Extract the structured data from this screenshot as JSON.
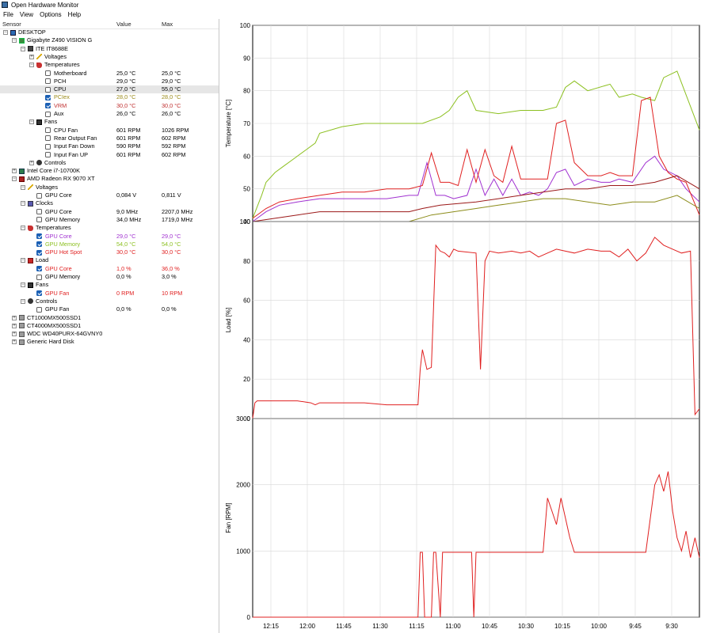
{
  "window": {
    "title": "Open Hardware Monitor"
  },
  "menu": [
    "File",
    "View",
    "Options",
    "Help"
  ],
  "columns": {
    "sensor": "Sensor",
    "value": "Value",
    "max": "Max"
  },
  "tree": [
    {
      "indent": 0,
      "exp": "-",
      "icon": "monitor",
      "label": "DESKTOP"
    },
    {
      "indent": 1,
      "exp": "-",
      "icon": "board",
      "label": "Gigabyte Z490 VISION G"
    },
    {
      "indent": 2,
      "exp": "-",
      "icon": "chip",
      "label": "ITE IT8688E"
    },
    {
      "indent": 3,
      "exp": "+",
      "icon": "volt",
      "label": "Voltages"
    },
    {
      "indent": 3,
      "exp": "-",
      "icon": "temp",
      "label": "Temperatures"
    },
    {
      "indent": 4,
      "check": false,
      "label": "Motherboard",
      "value": "25,0 °C",
      "max": "25,0 °C"
    },
    {
      "indent": 4,
      "check": false,
      "label": "PCH",
      "value": "29,0 °C",
      "max": "29,0 °C"
    },
    {
      "indent": 4,
      "check": false,
      "label": "CPU",
      "value": "27,0 °C",
      "max": "55,0 °C",
      "selected": true
    },
    {
      "indent": 4,
      "check": true,
      "label": "PCIex",
      "value": "28,0 °C",
      "max": "28,0 °C",
      "color": "#9b8b1a"
    },
    {
      "indent": 4,
      "check": true,
      "label": "VRM",
      "value": "30,0 °C",
      "max": "30,0 °C",
      "color": "#c03030"
    },
    {
      "indent": 4,
      "check": false,
      "label": "Aux",
      "value": "26,0 °C",
      "max": "26,0 °C"
    },
    {
      "indent": 3,
      "exp": "-",
      "icon": "fan",
      "label": "Fans"
    },
    {
      "indent": 4,
      "check": false,
      "label": "CPU Fan",
      "value": "601 RPM",
      "max": "1026 RPM"
    },
    {
      "indent": 4,
      "check": false,
      "label": "Rear Output Fan",
      "value": "601 RPM",
      "max": "602 RPM"
    },
    {
      "indent": 4,
      "check": false,
      "label": "Input Fan Down",
      "value": "590 RPM",
      "max": "592 RPM"
    },
    {
      "indent": 4,
      "check": false,
      "label": "Input Fan UP",
      "value": "601 RPM",
      "max": "602 RPM"
    },
    {
      "indent": 3,
      "exp": "+",
      "icon": "ctrl",
      "label": "Controls"
    },
    {
      "indent": 1,
      "exp": "+",
      "icon": "cpu",
      "label": "Intel Core i7-10700K"
    },
    {
      "indent": 1,
      "exp": "-",
      "icon": "gpu",
      "label": "AMD Radeon RX 9070 XT"
    },
    {
      "indent": 2,
      "exp": "-",
      "icon": "volt",
      "label": "Voltages"
    },
    {
      "indent": 3,
      "check": false,
      "label": "GPU Core",
      "value": "0,084 V",
      "max": "0,811 V"
    },
    {
      "indent": 2,
      "exp": "-",
      "icon": "clock",
      "label": "Clocks"
    },
    {
      "indent": 3,
      "check": false,
      "label": "GPU Core",
      "value": "9,0 MHz",
      "max": "2207,0 MHz"
    },
    {
      "indent": 3,
      "check": false,
      "label": "GPU Memory",
      "value": "34,0 MHz",
      "max": "1719,0 MHz"
    },
    {
      "indent": 2,
      "exp": "-",
      "icon": "temp",
      "label": "Temperatures"
    },
    {
      "indent": 3,
      "check": true,
      "label": "GPU Core",
      "value": "29,0 °C",
      "max": "29,0 °C",
      "color": "#a030d0"
    },
    {
      "indent": 3,
      "check": true,
      "label": "GPU Memory",
      "value": "54,0 °C",
      "max": "54,0 °C",
      "color": "#8cc020"
    },
    {
      "indent": 3,
      "check": true,
      "label": "GPU Hot Spot",
      "value": "30,0 °C",
      "max": "30,0 °C",
      "color": "#e02020"
    },
    {
      "indent": 2,
      "exp": "-",
      "icon": "load",
      "label": "Load"
    },
    {
      "indent": 3,
      "check": true,
      "label": "GPU Core",
      "value": "1,0 %",
      "max": "36,0 %",
      "color": "#e02020"
    },
    {
      "indent": 3,
      "check": false,
      "label": "GPU Memory",
      "value": "0,0 %",
      "max": "3,0 %"
    },
    {
      "indent": 2,
      "exp": "-",
      "icon": "fan",
      "label": "Fans"
    },
    {
      "indent": 3,
      "check": true,
      "label": "GPU Fan",
      "value": "0 RPM",
      "max": "10 RPM",
      "color": "#e02020"
    },
    {
      "indent": 2,
      "exp": "-",
      "icon": "ctrl",
      "label": "Controls"
    },
    {
      "indent": 3,
      "check": false,
      "label": "GPU Fan",
      "value": "0,0 %",
      "max": "0,0 %"
    },
    {
      "indent": 1,
      "exp": "+",
      "icon": "disk",
      "label": "CT1000MX500SSD1"
    },
    {
      "indent": 1,
      "exp": "+",
      "icon": "disk",
      "label": "CT4000MX500SSD1"
    },
    {
      "indent": 1,
      "exp": "+",
      "icon": "disk",
      "label": "WDC WD40PURX-64GVNY0"
    },
    {
      "indent": 1,
      "exp": "+",
      "icon": "disk",
      "label": "Generic Hard Disk"
    }
  ],
  "chart_data": [
    {
      "type": "line",
      "ylabel": "Temperature [°C]",
      "ylim": [
        40,
        100
      ],
      "yticks": [
        "100",
        "90",
        "80",
        "70",
        "60",
        "50",
        "40"
      ],
      "series": [
        {
          "color": "#8cc020",
          "x": [
            0,
            0.02,
            0.03,
            0.05,
            0.07,
            0.09,
            0.12,
            0.14,
            0.15,
            0.2,
            0.25,
            0.3,
            0.35,
            0.38,
            0.38,
            0.42,
            0.44,
            0.46,
            0.48,
            0.5,
            0.55,
            0.6,
            0.62,
            0.65,
            0.68,
            0.7,
            0.72,
            0.75,
            0.8,
            0.82,
            0.85,
            0.87,
            0.9,
            0.92,
            0.95,
            1.0
          ],
          "y": [
            41,
            48,
            52,
            55,
            57,
            59,
            62,
            64,
            67,
            69,
            70,
            70,
            70,
            70,
            70,
            72,
            74,
            78,
            80,
            74,
            73,
            74,
            74,
            74,
            75,
            81,
            83,
            80,
            82,
            78,
            79,
            78,
            77,
            84,
            86,
            68
          ]
        },
        {
          "color": "#a030d0",
          "x": [
            0,
            0.03,
            0.06,
            0.1,
            0.15,
            0.2,
            0.25,
            0.3,
            0.35,
            0.37,
            0.39,
            0.41,
            0.43,
            0.45,
            0.48,
            0.5,
            0.52,
            0.54,
            0.56,
            0.58,
            0.6,
            0.62,
            0.64,
            0.66,
            0.68,
            0.7,
            0.72,
            0.75,
            0.78,
            0.8,
            0.82,
            0.85,
            0.88,
            0.9,
            0.92,
            0.95,
            0.97,
            1.0
          ],
          "y": [
            40,
            43,
            45,
            46,
            47,
            47,
            47,
            47,
            48,
            48,
            58,
            48,
            48,
            47,
            48,
            56,
            48,
            53,
            48,
            53,
            48,
            49,
            48,
            50,
            55,
            56,
            51,
            53,
            52,
            52,
            53,
            52,
            58,
            60,
            56,
            54,
            50,
            46
          ]
        },
        {
          "color": "#e02020",
          "x": [
            0,
            0.03,
            0.06,
            0.1,
            0.15,
            0.2,
            0.25,
            0.3,
            0.35,
            0.38,
            0.4,
            0.42,
            0.44,
            0.46,
            0.48,
            0.5,
            0.52,
            0.54,
            0.56,
            0.58,
            0.6,
            0.62,
            0.64,
            0.66,
            0.68,
            0.7,
            0.72,
            0.75,
            0.78,
            0.8,
            0.82,
            0.85,
            0.87,
            0.89,
            0.91,
            0.93,
            0.95,
            0.97,
            1.0
          ],
          "y": [
            41,
            44,
            46,
            47,
            48,
            49,
            49,
            50,
            50,
            51,
            61,
            52,
            52,
            51,
            62,
            52,
            62,
            54,
            52,
            63,
            53,
            53,
            53,
            53,
            70,
            71,
            58,
            54,
            54,
            55,
            54,
            54,
            77,
            78,
            60,
            55,
            53,
            52,
            42
          ]
        },
        {
          "color": "#9b1818",
          "x": [
            0,
            0.05,
            0.1,
            0.15,
            0.2,
            0.25,
            0.3,
            0.35,
            0.38,
            0.42,
            0.5,
            0.55,
            0.6,
            0.65,
            0.7,
            0.75,
            0.8,
            0.85,
            0.9,
            0.95,
            1.0
          ],
          "y": [
            40,
            41,
            42,
            43,
            43,
            43,
            43,
            43,
            44,
            45,
            46,
            47,
            48,
            49,
            50,
            50,
            51,
            51,
            52,
            54,
            50
          ]
        },
        {
          "color": "#8c8c1a",
          "x": [
            0,
            0.05,
            0.1,
            0.15,
            0.2,
            0.25,
            0.3,
            0.35,
            0.4,
            0.45,
            0.5,
            0.55,
            0.6,
            0.65,
            0.7,
            0.75,
            0.8,
            0.85,
            0.9,
            0.95,
            1.0
          ],
          "y": [
            40,
            40,
            40,
            40,
            40,
            40,
            40,
            40,
            42,
            43,
            44,
            45,
            46,
            47,
            47,
            46,
            45,
            46,
            46,
            48,
            44
          ]
        }
      ]
    },
    {
      "type": "line",
      "ylabel": "Load [%]",
      "ylim": [
        0,
        100
      ],
      "yticks": [
        "100",
        "80",
        "60",
        "40",
        "20",
        "0"
      ],
      "series": [
        {
          "color": "#e02020",
          "x": [
            0,
            0.005,
            0.01,
            0.05,
            0.1,
            0.13,
            0.14,
            0.15,
            0.2,
            0.25,
            0.3,
            0.35,
            0.37,
            0.375,
            0.38,
            0.39,
            0.4,
            0.41,
            0.42,
            0.43,
            0.44,
            0.45,
            0.46,
            0.5,
            0.51,
            0.52,
            0.53,
            0.55,
            0.58,
            0.6,
            0.62,
            0.64,
            0.66,
            0.68,
            0.7,
            0.72,
            0.75,
            0.78,
            0.8,
            0.82,
            0.84,
            0.86,
            0.88,
            0.9,
            0.92,
            0.94,
            0.96,
            0.98,
            0.99,
            1.0
          ],
          "y": [
            0,
            8,
            9,
            9,
            9,
            8,
            7,
            8,
            8,
            8,
            7,
            7,
            7,
            25,
            35,
            25,
            26,
            88,
            85,
            84,
            82,
            86,
            85,
            84,
            25,
            80,
            85,
            84,
            85,
            84,
            85,
            82,
            84,
            86,
            85,
            84,
            86,
            85,
            85,
            82,
            86,
            80,
            84,
            92,
            88,
            86,
            84,
            85,
            2,
            5
          ]
        }
      ]
    },
    {
      "type": "line",
      "ylabel": "Fan [RPM]",
      "ylim": [
        0,
        3000
      ],
      "yticks": [
        "3000",
        "2000",
        "1000",
        "0"
      ],
      "xticks": [
        "12:15",
        "12:00",
        "11:45",
        "11:30",
        "11:15",
        "11:00",
        "10:45",
        "10:30",
        "10:15",
        "10:00",
        "9:45",
        "9:30"
      ],
      "series": [
        {
          "color": "#e02020",
          "x": [
            0,
            0.37,
            0.375,
            0.38,
            0.385,
            0.4,
            0.405,
            0.41,
            0.42,
            0.425,
            0.43,
            0.49,
            0.495,
            0.5,
            0.51,
            0.52,
            0.6,
            0.65,
            0.66,
            0.67,
            0.68,
            0.69,
            0.7,
            0.71,
            0.72,
            0.75,
            0.8,
            0.88,
            0.9,
            0.91,
            0.92,
            0.93,
            0.94,
            0.95,
            0.96,
            0.97,
            0.98,
            0.99,
            1.0
          ],
          "y": [
            0,
            0,
            980,
            980,
            0,
            0,
            980,
            980,
            0,
            980,
            980,
            980,
            0,
            980,
            980,
            980,
            980,
            980,
            1800,
            1600,
            1400,
            1800,
            1500,
            1200,
            980,
            980,
            980,
            980,
            2000,
            2150,
            1900,
            2200,
            1600,
            1200,
            1000,
            1300,
            900,
            1200,
            900
          ]
        }
      ]
    }
  ]
}
